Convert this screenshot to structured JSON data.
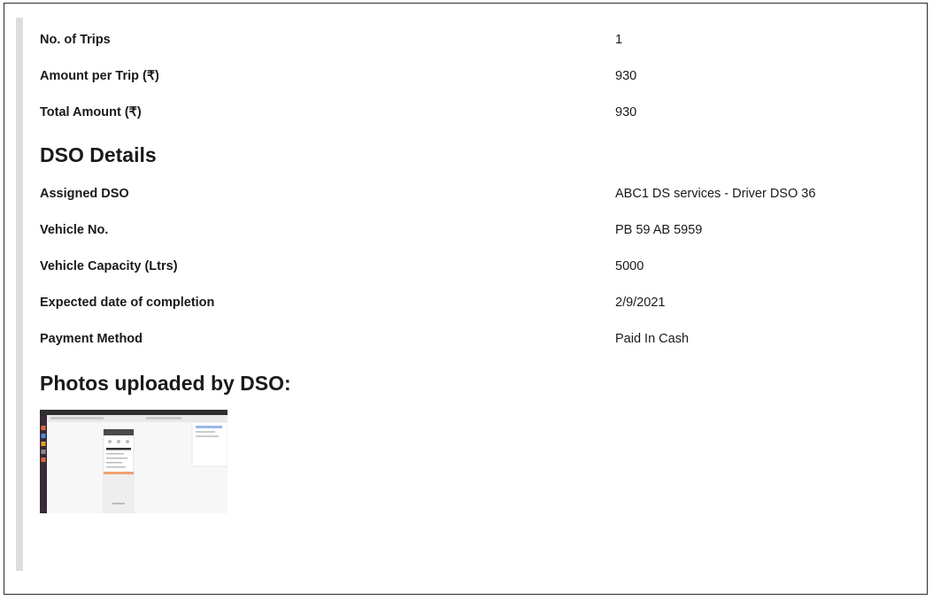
{
  "trip": {
    "rows": [
      {
        "label": "No. of Trips",
        "value": "1"
      },
      {
        "label": "Amount per Trip (₹)",
        "value": "930"
      },
      {
        "label": "Total Amount (₹)",
        "value": "930"
      }
    ]
  },
  "dso": {
    "title": "DSO Details",
    "rows": [
      {
        "label": "Assigned DSO",
        "value": "ABC1 DS services - Driver DSO 36"
      },
      {
        "label": "Vehicle No.",
        "value": "PB 59 AB 5959"
      },
      {
        "label": "Vehicle Capacity (Ltrs)",
        "value": "5000"
      },
      {
        "label": "Expected date of completion",
        "value": "2/9/2021"
      },
      {
        "label": "Payment Method",
        "value": "Paid In Cash"
      }
    ]
  },
  "photos": {
    "title": "Photos uploaded by DSO:",
    "count": 1
  },
  "colors": {
    "accent_bar": "#dedede",
    "border": "#2b2b2b",
    "text": "#1a1a1a"
  }
}
